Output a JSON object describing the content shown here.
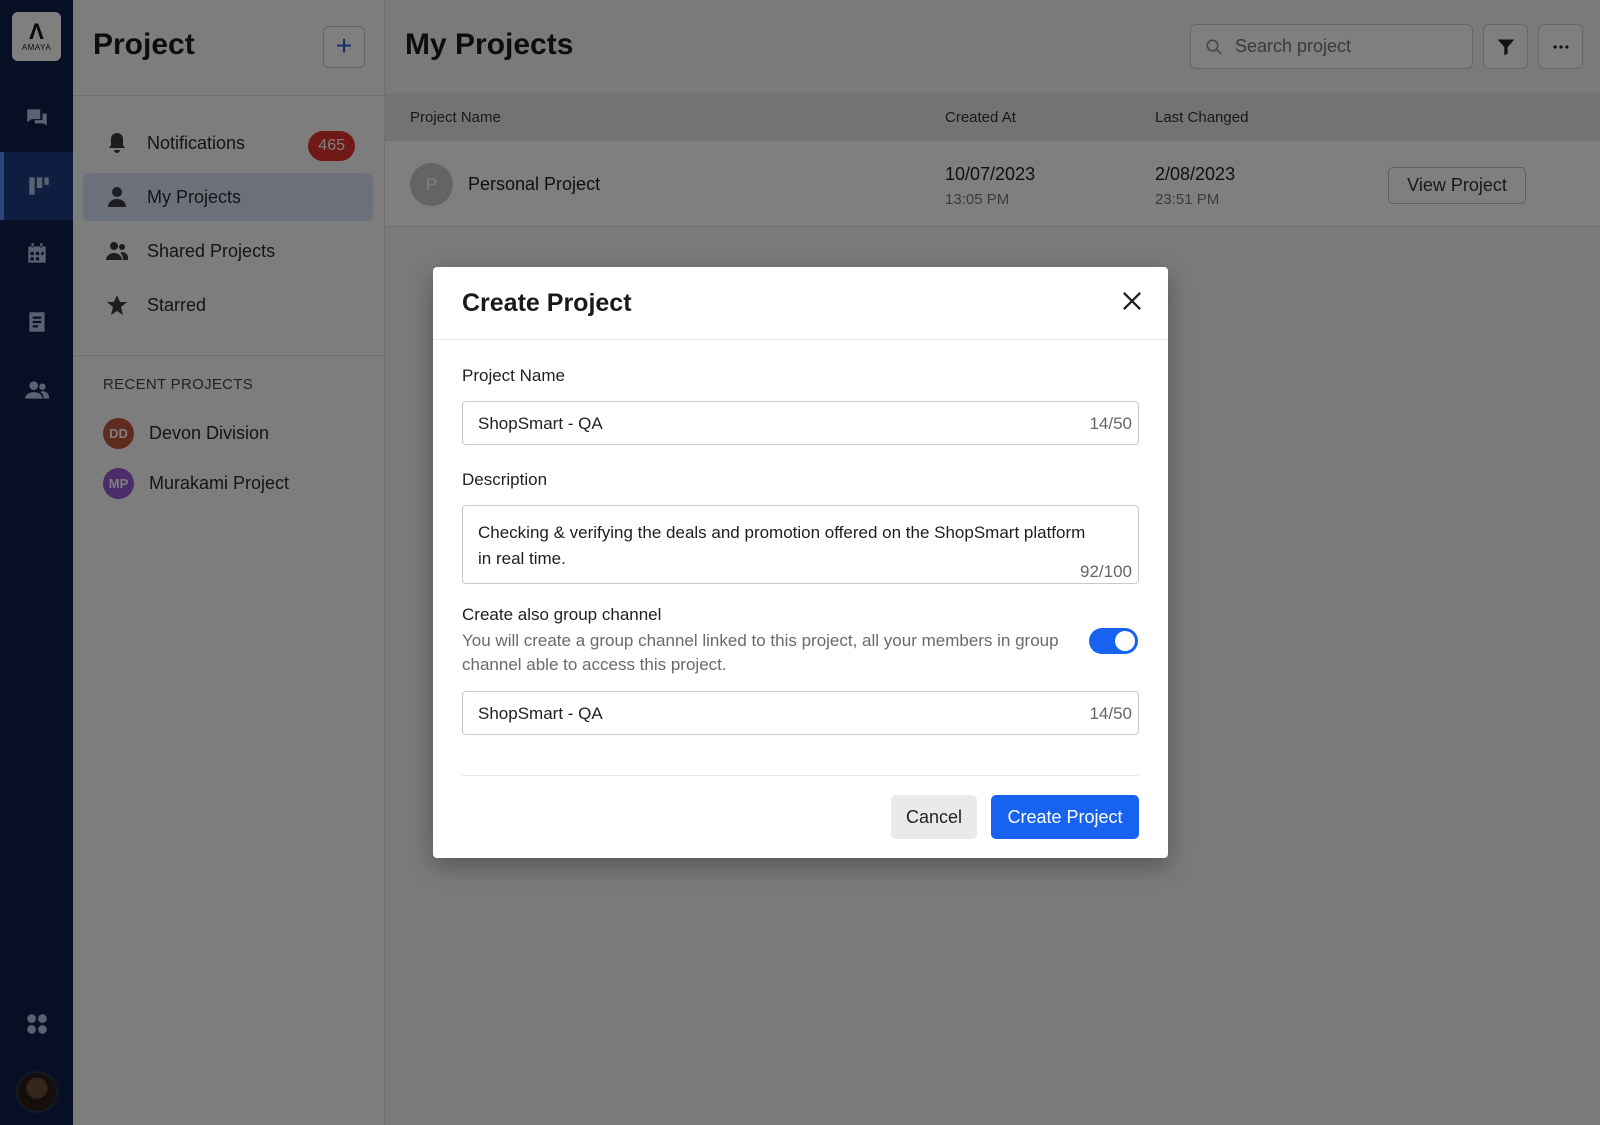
{
  "rail": {
    "logo_text": "AMAYA",
    "logo_mark": "Λ"
  },
  "sidebar": {
    "title": "Project",
    "items": [
      {
        "label": "Notifications",
        "badge": "465"
      },
      {
        "label": "My Projects"
      },
      {
        "label": "Shared Projects"
      },
      {
        "label": "Starred"
      }
    ],
    "recent_heading": "RECENT PROJECTS",
    "recent": [
      {
        "initials": "DD",
        "label": "Devon Division",
        "color": "#c0573f"
      },
      {
        "initials": "MP",
        "label": "Murakami Project",
        "color": "#9b59d4"
      }
    ]
  },
  "main": {
    "title": "My Projects",
    "search_placeholder": "Search project",
    "columns": [
      "Project Name",
      "Created At",
      "Last Changed"
    ],
    "rows": [
      {
        "initial": "P",
        "name": "Personal Project",
        "created_date": "10/07/2023",
        "created_time": "13:05 PM",
        "changed_date": "2/08/2023",
        "changed_time": "23:51 PM",
        "action": "View Project"
      }
    ]
  },
  "modal": {
    "title": "Create Project",
    "project_name_label": "Project Name",
    "project_name_value": "ShopSmart - QA",
    "project_name_count": "14/50",
    "description_label": "Description",
    "description_value": "Checking & verifying the deals and promotion offered on the ShopSmart platform in real time.",
    "description_count": "92/100",
    "channel_title": "Create also group channel",
    "channel_desc": "You will create a group channel linked to this project, all your members in group channel able to access this project.",
    "channel_enabled": true,
    "channel_name_value": "ShopSmart - QA",
    "channel_name_count": "14/50",
    "cancel_label": "Cancel",
    "create_label": "Create Project"
  },
  "colors": {
    "rail_bg": "#0e1f4a",
    "accent": "#1763f0",
    "badge": "#e0322e"
  }
}
